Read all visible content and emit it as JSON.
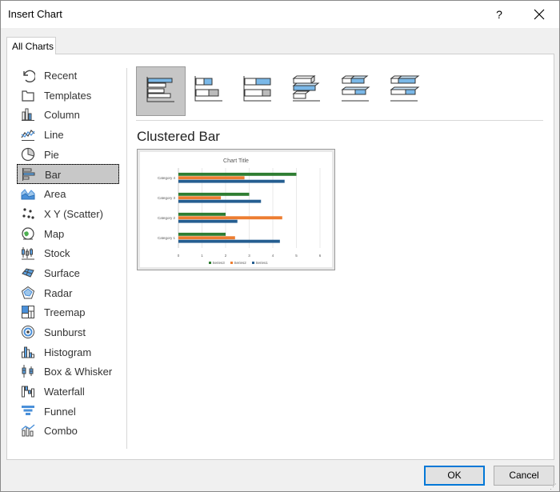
{
  "window": {
    "title": "Insert Chart",
    "help_label": "?"
  },
  "tabs": [
    {
      "label": "All Charts"
    }
  ],
  "sidebar": {
    "items": [
      {
        "label": "Recent",
        "icon": "recent-icon"
      },
      {
        "label": "Templates",
        "icon": "templates-icon"
      },
      {
        "label": "Column",
        "icon": "column-chart-icon"
      },
      {
        "label": "Line",
        "icon": "line-chart-icon"
      },
      {
        "label": "Pie",
        "icon": "pie-chart-icon"
      },
      {
        "label": "Bar",
        "icon": "bar-chart-icon",
        "selected": true
      },
      {
        "label": "Area",
        "icon": "area-chart-icon"
      },
      {
        "label": "X Y (Scatter)",
        "icon": "scatter-chart-icon"
      },
      {
        "label": "Map",
        "icon": "map-chart-icon"
      },
      {
        "label": "Stock",
        "icon": "stock-chart-icon"
      },
      {
        "label": "Surface",
        "icon": "surface-chart-icon"
      },
      {
        "label": "Radar",
        "icon": "radar-chart-icon"
      },
      {
        "label": "Treemap",
        "icon": "treemap-chart-icon"
      },
      {
        "label": "Sunburst",
        "icon": "sunburst-chart-icon"
      },
      {
        "label": "Histogram",
        "icon": "histogram-chart-icon"
      },
      {
        "label": "Box & Whisker",
        "icon": "box-whisker-chart-icon"
      },
      {
        "label": "Waterfall",
        "icon": "waterfall-chart-icon"
      },
      {
        "label": "Funnel",
        "icon": "funnel-chart-icon"
      },
      {
        "label": "Combo",
        "icon": "combo-chart-icon"
      }
    ]
  },
  "subtypes": [
    {
      "icon": "clustered-bar-icon",
      "selected": true
    },
    {
      "icon": "stacked-bar-icon"
    },
    {
      "icon": "100-stacked-bar-icon"
    },
    {
      "icon": "3d-clustered-bar-icon"
    },
    {
      "icon": "3d-stacked-bar-icon"
    },
    {
      "icon": "3d-100-stacked-bar-icon"
    }
  ],
  "selected_subtype_name": "Clustered Bar",
  "colors": {
    "series1": "#255e91",
    "series2": "#ed7d31",
    "series3": "#2e7d32",
    "selection": "#c6c6c6",
    "ok_border": "#0078d7"
  },
  "chart_data": {
    "type": "bar",
    "orientation": "horizontal",
    "title": "Chart Title",
    "categories": [
      "Category 1",
      "Category 2",
      "Category 3",
      "Category 4"
    ],
    "series": [
      {
        "name": "Series1",
        "values": [
          4.3,
          2.5,
          3.5,
          4.5
        ]
      },
      {
        "name": "Series2",
        "values": [
          2.4,
          4.4,
          1.8,
          2.8
        ]
      },
      {
        "name": "Series3",
        "values": [
          2,
          2,
          3,
          5
        ]
      }
    ],
    "xlim": [
      0,
      6
    ],
    "xticks": [
      "0",
      "1",
      "2",
      "3",
      "4",
      "5",
      "6"
    ],
    "grid": true,
    "legend": "bottom",
    "legend_order": [
      "Series3",
      "Series2",
      "Series1"
    ]
  },
  "buttons": {
    "ok": "OK",
    "cancel": "Cancel"
  }
}
